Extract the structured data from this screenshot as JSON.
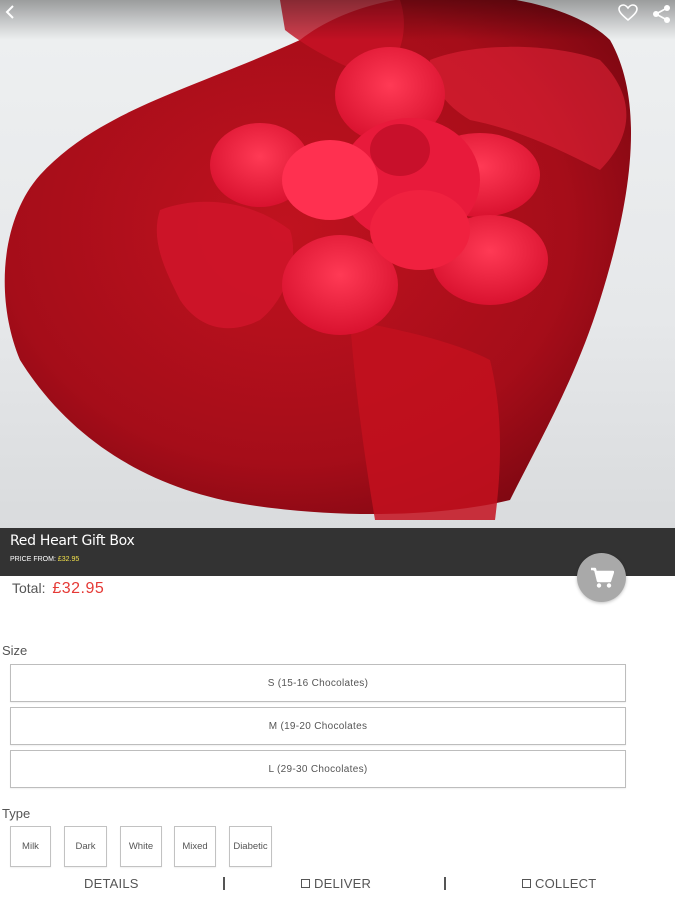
{
  "product": {
    "name": "Red Heart Gift Box",
    "price_from_label": "PRICE FROM:",
    "price_from_value": "£32.95"
  },
  "total": {
    "label": "Total:",
    "amount": "£32.95"
  },
  "size": {
    "label": "Size",
    "options": [
      "S (15-16 Chocolates)",
      "M (19-20 Chocolates",
      "L (29-30 Chocolates)"
    ]
  },
  "type": {
    "label": "Type",
    "options": [
      "Milk",
      "Dark",
      "White",
      "Mixed",
      "Diabetic"
    ]
  },
  "tabs": {
    "details": "DETAILS",
    "deliver": "DELIVER",
    "collect": "COLLECT"
  },
  "icons": {
    "back": "chevron-left-icon",
    "favorite": "heart-outline-icon",
    "share": "share-icon",
    "cart": "shopping-cart-icon"
  },
  "colors": {
    "title_bar": "#333333",
    "price_highlight": "#f2e14b",
    "total_amount": "#e53935",
    "cart_button": "#a9a9a9",
    "product_red": "#b0101c"
  }
}
